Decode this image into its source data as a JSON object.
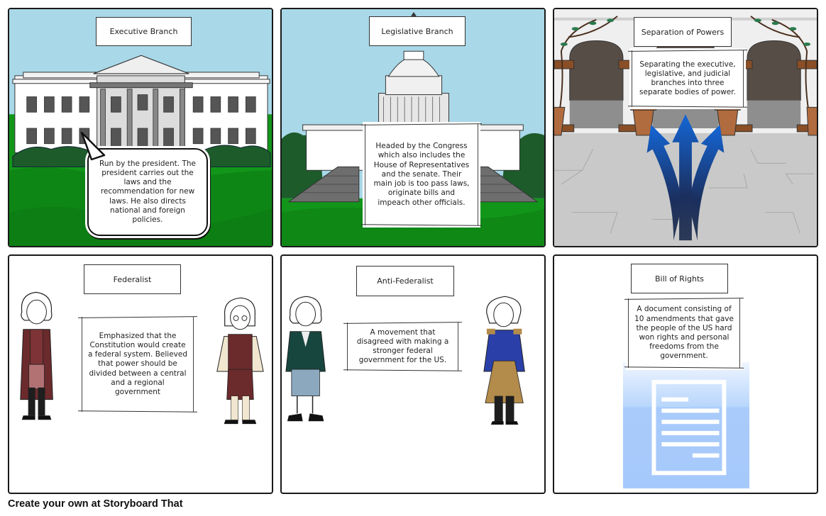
{
  "storyboard": {
    "panels": [
      {
        "title": "Executive Branch",
        "text": "Run by the president. The president carries out the laws and the recommendation for new laws. He also directs national and foreign policies.",
        "scene": "white-house",
        "note_style": "speech-bubble"
      },
      {
        "title": "Legislative Branch",
        "text": "Headed by the Congress which also includes the House of Representatives and the senate. Their main job is too pass laws, originate bills and impeach other officials.",
        "scene": "capitol-building",
        "note_style": "scroll"
      },
      {
        "title": "Separation of Powers",
        "text": "Separating the executive, legislative, and judicial branches into three separate bodies of power.",
        "scene": "courtyard-with-three-arrows",
        "note_style": "scroll"
      },
      {
        "title": "Federalist",
        "text": "Emphasized that the Constitution would create a federal system. Believed that power should be divided between a central and a regional government",
        "scene": "two-colonial-figures",
        "note_style": "scroll"
      },
      {
        "title": "Anti-Federalist",
        "text": "A movement that disagreed with making a stronger federal government for the US.",
        "scene": "two-colonial-figures",
        "note_style": "scroll"
      },
      {
        "title": "Bill of Rights",
        "text": "A document consisting of 10 amendments that gave the people of the US hard won rights and personal freedoms from the government.",
        "scene": "document-icon",
        "note_style": "scroll"
      }
    ]
  },
  "footer": {
    "label": "Create your own at Storyboard That"
  },
  "colors": {
    "sky": "#a9d8e8",
    "grass_light": "#12961a",
    "grass_dark": "#0b7a12",
    "bush": "#1d5b2b",
    "courtyard_floor": "#c9c9c9",
    "arrow_blue": "#1a5fc9",
    "arrow_navy": "#1b2a4e",
    "document_blue": "#a8cdfb"
  }
}
